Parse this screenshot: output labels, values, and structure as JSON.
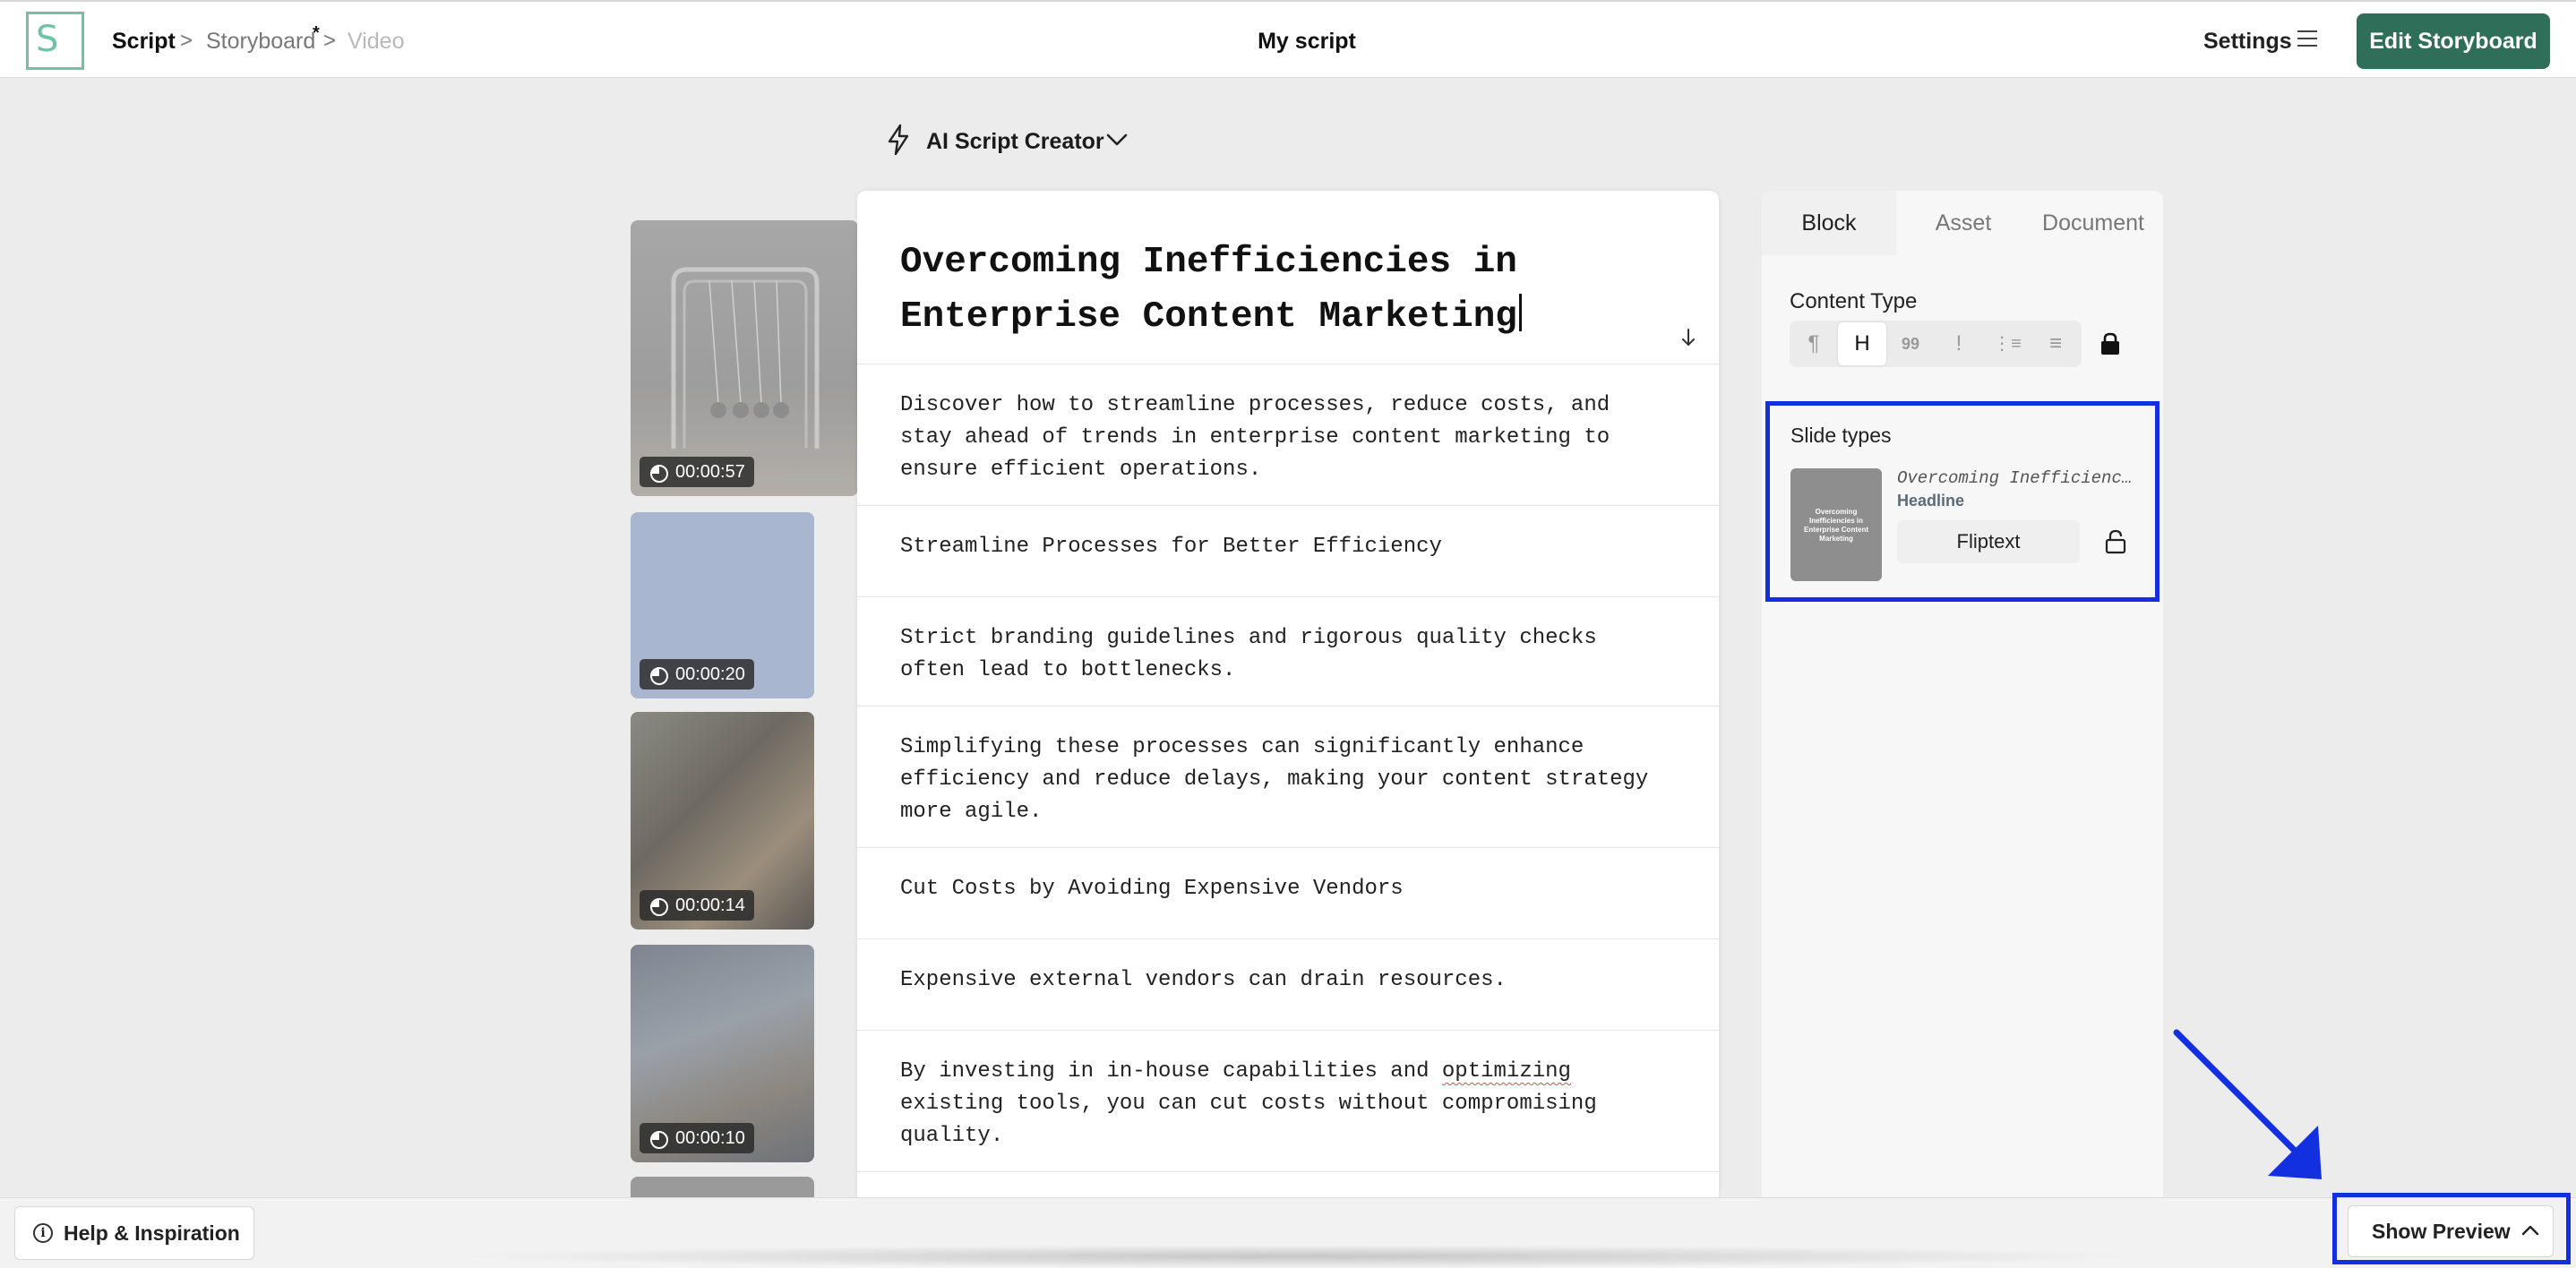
{
  "header": {
    "breadcrumb": {
      "script": "Script",
      "storyboard": "Storyboard",
      "unsaved_marker": "*",
      "video": "Video",
      "separator": ">"
    },
    "title": "My script",
    "settings_label": "Settings",
    "edit_storyboard_label": "Edit Storyboard",
    "logo_letter": "S",
    "logo_suffix": "_"
  },
  "ai_creator": {
    "label": "AI Script Creator"
  },
  "thumbnails": [
    {
      "duration": "00:00:57"
    },
    {
      "duration": "00:00:20"
    },
    {
      "duration": "00:00:14"
    },
    {
      "duration": "00:00:10"
    }
  ],
  "editor": {
    "title": "Overcoming Inefficiencies in Enterprise Content Marketing",
    "blocks": [
      "Discover how to streamline processes, reduce costs, and stay ahead of trends in enterprise content marketing to ensure efficient operations.",
      "Streamline Processes for Better Efficiency",
      "Strict branding guidelines and rigorous quality checks often lead to bottlenecks.",
      "Simplifying these processes can significantly enhance efficiency and reduce delays, making your content strategy more agile.",
      "Cut Costs by Avoiding Expensive Vendors",
      "Expensive external vendors can drain resources.",
      {
        "before": "By investing in in-house capabilities and ",
        "flagged": "optimizing",
        "after": " existing tools, you can cut costs without compromising quality."
      }
    ]
  },
  "panel": {
    "tabs": [
      "Block",
      "Asset",
      "Document"
    ],
    "active_tab": "Block",
    "content_type_label": "Content Type",
    "content_types": [
      {
        "icon": "paragraph-icon",
        "glyph": "¶"
      },
      {
        "icon": "heading-icon",
        "glyph": "H"
      },
      {
        "icon": "quote-icon",
        "glyph": "99"
      },
      {
        "icon": "exclamation-icon",
        "glyph": "!"
      },
      {
        "icon": "numbered-list-icon",
        "glyph": "⋮≡"
      },
      {
        "icon": "bullet-list-icon",
        "glyph": "≡"
      }
    ],
    "selected_content_type": "H",
    "slide_types_label": "Slide types",
    "slide": {
      "name": "Overcoming Inefficiencies in Enterprise Content Marketing",
      "kind": "Headline",
      "layout_label": "Fliptext",
      "thumb_text": "Overcoming Inefficiencies in Enterprise Content Marketing"
    }
  },
  "footer": {
    "help_label": "Help & Inspiration",
    "preview_label": "Show Preview"
  },
  "colors": {
    "brand_green": "#2f6e58",
    "logo_green": "#6fc2a5",
    "annotation_blue": "#1330e0",
    "spellcheck_red": "#e04b4b"
  }
}
